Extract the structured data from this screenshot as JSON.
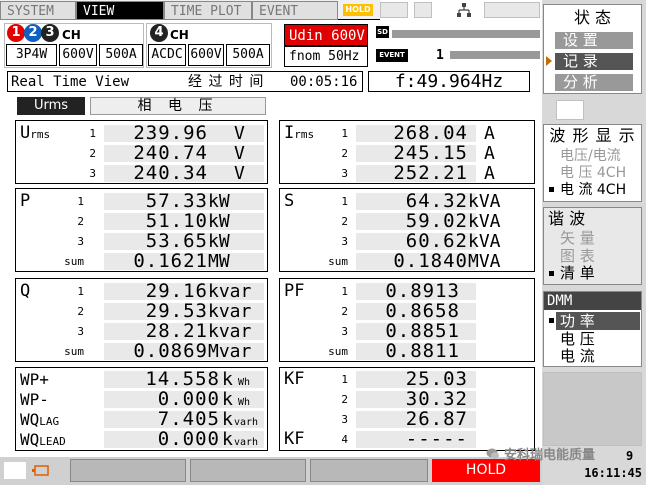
{
  "tabs": [
    {
      "label": "SYSTEM",
      "active": false
    },
    {
      "label": "VIEW",
      "active": true
    },
    {
      "label": "TIME PLOT",
      "active": false
    },
    {
      "label": "EVENT",
      "active": false
    }
  ],
  "hold_tag": "HOLD",
  "status": {
    "sd_label": "SD",
    "event_label": "EVENT",
    "event_count": "1"
  },
  "channels": {
    "group1": {
      "numbers": [
        "1",
        "2",
        "3"
      ],
      "ch_label": "CH",
      "wiring": "3P4W",
      "voltage": "600V",
      "current": "500A"
    },
    "group2": {
      "number": "4",
      "ch_label": "CH",
      "coupling": "ACDC",
      "voltage": "600V",
      "current": "500A"
    }
  },
  "udin": "Udin 600V",
  "fnom": "fnom  50Hz",
  "view_title": "Real Time View",
  "elapsed_label": "经 过 时 间",
  "elapsed_time": "00:05:16",
  "frequency": "f:49.964Hz",
  "mode_button": "Urms",
  "phase_label": "相 电 压",
  "panels": {
    "urms": {
      "name": "U",
      "sub": "rms",
      "rows": [
        {
          "idx": "1",
          "value": "239.96",
          "unit": "V"
        },
        {
          "idx": "2",
          "value": "240.74",
          "unit": "V"
        },
        {
          "idx": "3",
          "value": "240.34",
          "unit": "V"
        }
      ]
    },
    "irms": {
      "name": "I",
      "sub": "rms",
      "rows": [
        {
          "idx": "1",
          "value": "268.04",
          "unit": "A"
        },
        {
          "idx": "2",
          "value": "245.15",
          "unit": "A"
        },
        {
          "idx": "3",
          "value": "252.21",
          "unit": "A"
        }
      ]
    },
    "p": {
      "name": "P",
      "rows": [
        {
          "idx": "1",
          "value": "57.33",
          "unit": "kW"
        },
        {
          "idx": "2",
          "value": "51.10",
          "unit": "kW"
        },
        {
          "idx": "3",
          "value": "53.65",
          "unit": "kW"
        },
        {
          "idx": "sum",
          "value": "0.1621",
          "unit": "MW"
        }
      ]
    },
    "s": {
      "name": "S",
      "rows": [
        {
          "idx": "1",
          "value": "64.32",
          "unit": "kVA"
        },
        {
          "idx": "2",
          "value": "59.02",
          "unit": "kVA"
        },
        {
          "idx": "3",
          "value": "60.62",
          "unit": "kVA"
        },
        {
          "idx": "sum",
          "value": "0.1840",
          "unit": "MVA"
        }
      ]
    },
    "q": {
      "name": "Q",
      "rows": [
        {
          "idx": "1",
          "value": "29.16",
          "unit": "kvar"
        },
        {
          "idx": "2",
          "value": "29.53",
          "unit": "kvar"
        },
        {
          "idx": "3",
          "value": "28.21",
          "unit": "kvar"
        },
        {
          "idx": "sum",
          "value": "0.0869",
          "unit": "Mvar"
        }
      ]
    },
    "pf": {
      "name": "PF",
      "rows": [
        {
          "idx": "1",
          "value": "0.8913"
        },
        {
          "idx": "2",
          "value": "0.8658"
        },
        {
          "idx": "3",
          "value": "0.8851"
        },
        {
          "idx": "sum",
          "value": "0.8811"
        }
      ]
    },
    "wp": {
      "rows": [
        {
          "name": "WP+",
          "value": "14.558",
          "unit_big": "k",
          "unit_small": "Wh"
        },
        {
          "name": "WP-",
          "value": "0.000",
          "unit_big": "k",
          "unit_small": "Wh"
        },
        {
          "name": "WQ",
          "name_sub": "LAG",
          "value": "7.405",
          "unit_big": "k",
          "unit_small": "varh"
        },
        {
          "name": "WQ",
          "name_sub": "LEAD",
          "value": "0.000",
          "unit_big": "k",
          "unit_small": "varh"
        }
      ]
    },
    "kf": {
      "name": "KF",
      "name_bottom": "KF",
      "rows": [
        {
          "idx": "1",
          "value": "25.03"
        },
        {
          "idx": "2",
          "value": "30.32"
        },
        {
          "idx": "3",
          "value": "26.87"
        },
        {
          "idx": "4",
          "value": "-----"
        }
      ]
    }
  },
  "menu": {
    "state_title": "状 态",
    "state_buttons": [
      "设 置",
      "记 录",
      "分 析"
    ],
    "waveform_title": "波 形 显 示",
    "waveform_items": [
      "电压/电流",
      "电 压 4CH",
      "电 流 4CH"
    ],
    "harmonic_title": "谐 波",
    "harmonic_items": [
      "矢 量",
      "图 表",
      "清 单"
    ],
    "dmm_title": "DMM",
    "dmm_items": [
      "功 率",
      "电 压",
      "电 流"
    ]
  },
  "bottom": {
    "hold_label": "HOLD",
    "watermark": "安科瑞电能质量",
    "date_partial": "9",
    "time": "16:11:45"
  },
  "colors": {
    "alarm_red": "#e00000",
    "hold_yellow": "#ffc000",
    "ch_red": "#e00000",
    "ch_blue": "#1060c0",
    "ch_dark": "#222222"
  }
}
